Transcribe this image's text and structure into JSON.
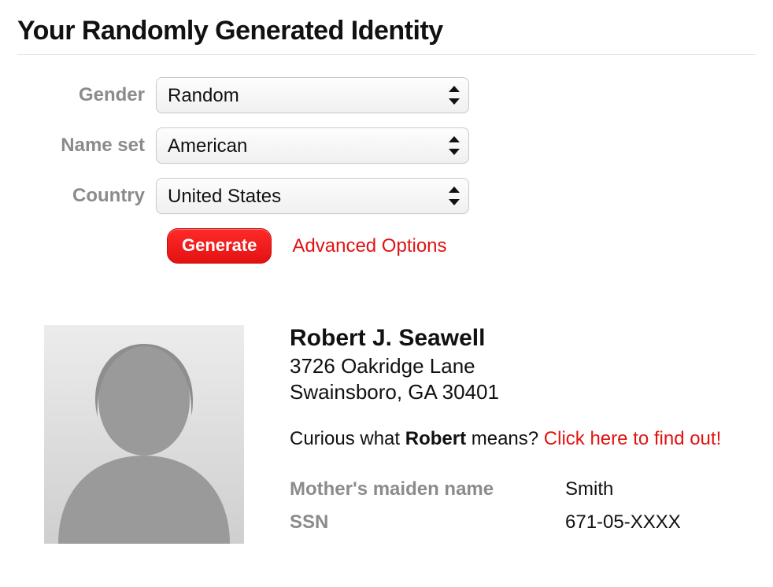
{
  "header": {
    "title": "Your Randomly Generated Identity"
  },
  "form": {
    "gender": {
      "label": "Gender",
      "value": "Random"
    },
    "nameset": {
      "label": "Name set",
      "value": "American"
    },
    "country": {
      "label": "Country",
      "value": "United States"
    },
    "generate_label": "Generate",
    "advanced_label": "Advanced Options"
  },
  "identity": {
    "name": "Robert J. Seawell",
    "address_line1": "3726 Oakridge Lane",
    "address_line2": "Swainsboro, GA 30401",
    "curious_prefix": "Curious what ",
    "first_name": "Robert",
    "curious_suffix": " means? ",
    "curious_link_text": "Click here to find out!",
    "fields": {
      "maiden": {
        "label": "Mother's maiden name",
        "value": "Smith"
      },
      "ssn": {
        "label": "SSN",
        "value": "671-05-XXXX"
      }
    }
  }
}
